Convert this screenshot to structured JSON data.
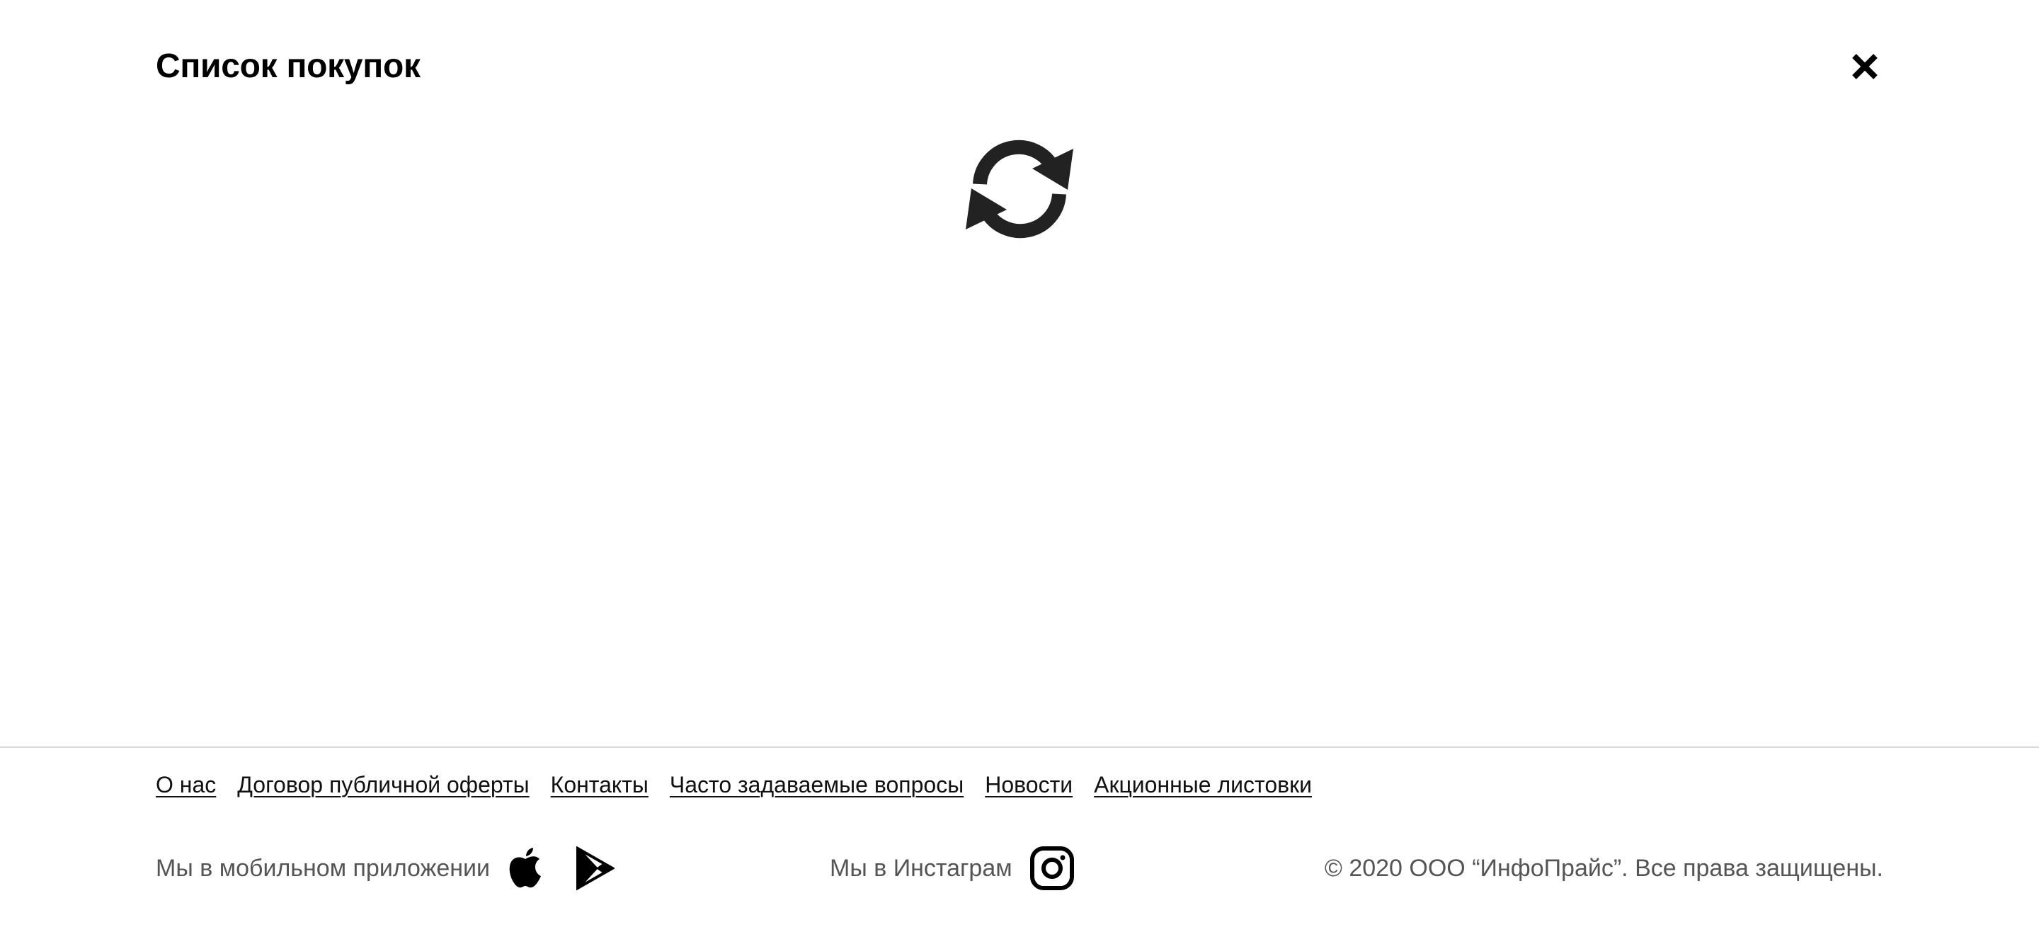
{
  "modal": {
    "title": "Список покупок",
    "close_icon": "close-icon",
    "loading_icon": "refresh-icon"
  },
  "footer": {
    "links": [
      {
        "label": "О нас"
      },
      {
        "label": "Договор публичной оферты"
      },
      {
        "label": "Контакты"
      },
      {
        "label": "Часто задаваемые вопросы"
      },
      {
        "label": "Новости"
      },
      {
        "label": "Акционные листовки"
      }
    ],
    "mobile_label": "Мы в мобильном приложении",
    "app_store_icon": "apple-icon",
    "play_store_icon": "google-play-icon",
    "instagram_label": "Мы в Инстаграм",
    "instagram_icon": "instagram-icon",
    "copyright": "© 2020 ООО “ИнфоПрайс”. Все права защищены."
  },
  "colors": {
    "text": "#111111",
    "muted_text": "#555555",
    "divider": "#d9d9d9",
    "background": "#ffffff"
  }
}
